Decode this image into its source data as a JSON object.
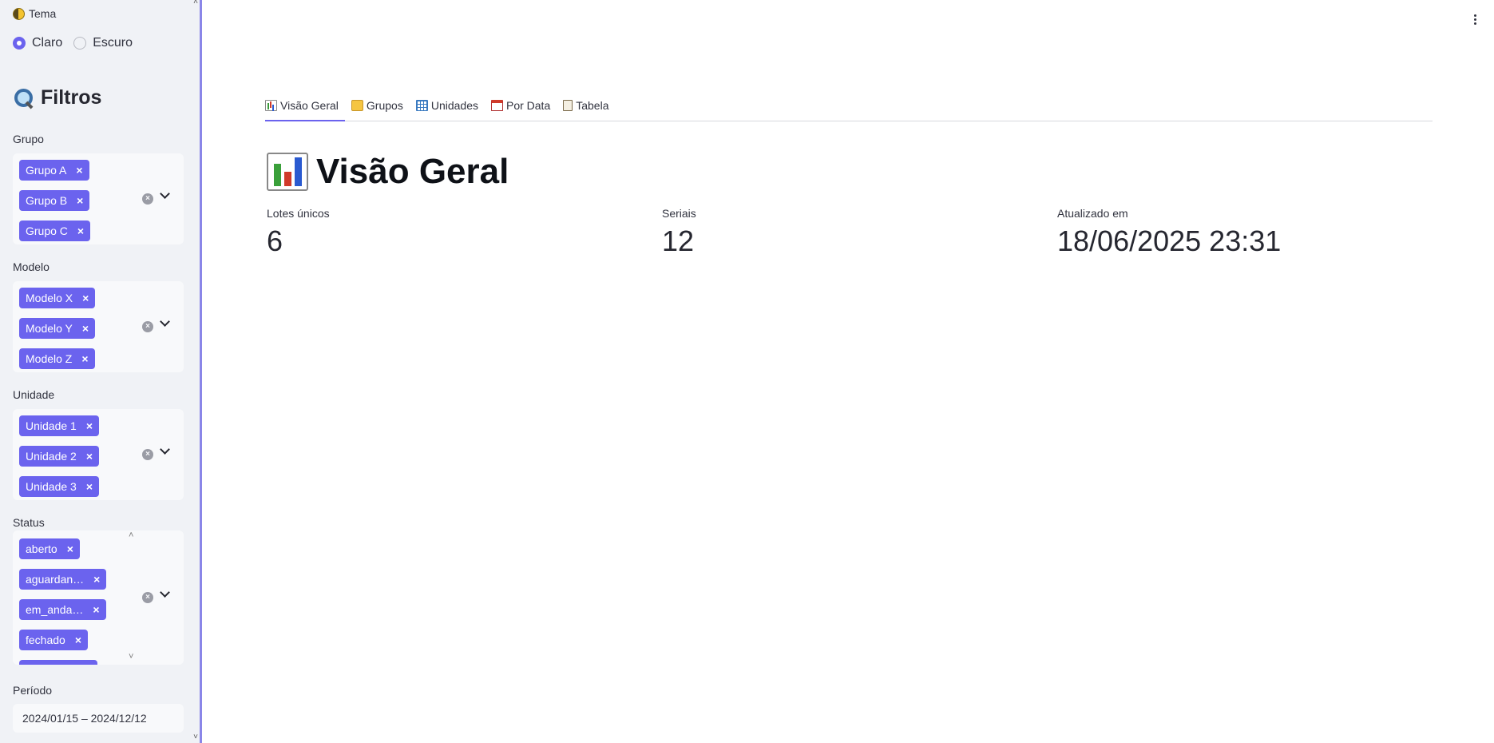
{
  "sidebar": {
    "theme": {
      "label": "Tema",
      "options": [
        "Claro",
        "Escuro"
      ],
      "selected": "Claro"
    },
    "filters_title": "Filtros",
    "grupo": {
      "label": "Grupo",
      "tags": [
        "Grupo A",
        "Grupo B",
        "Grupo C"
      ]
    },
    "modelo": {
      "label": "Modelo",
      "tags": [
        "Modelo X",
        "Modelo Y",
        "Modelo Z"
      ]
    },
    "unidade": {
      "label": "Unidade",
      "tags": [
        "Unidade 1",
        "Unidade 2",
        "Unidade 3"
      ]
    },
    "status": {
      "label": "Status",
      "tags": [
        "aberto",
        "aguardan…",
        "em_anda…",
        "fechado"
      ]
    },
    "periodo": {
      "label": "Período",
      "value": "2024/01/15 – 2024/12/12"
    }
  },
  "main": {
    "tabs": [
      {
        "label": "Visão Geral",
        "icon": "bar-chart-icon",
        "active": true
      },
      {
        "label": "Grupos",
        "icon": "folder-icon",
        "active": false
      },
      {
        "label": "Unidades",
        "icon": "grid-icon",
        "active": false
      },
      {
        "label": "Por Data",
        "icon": "calendar-icon",
        "active": false
      },
      {
        "label": "Tabela",
        "icon": "clipboard-icon",
        "active": false
      }
    ],
    "title": "Visão Geral",
    "metrics": [
      {
        "label": "Lotes únicos",
        "value": "6"
      },
      {
        "label": "Seriais",
        "value": "12"
      },
      {
        "label": "Atualizado em",
        "value": "18/06/2025 23:31"
      }
    ]
  },
  "colors": {
    "accent": "#6b63ee",
    "sidebar_bg": "#f0f2f6",
    "input_bg": "#f8f9fb"
  }
}
